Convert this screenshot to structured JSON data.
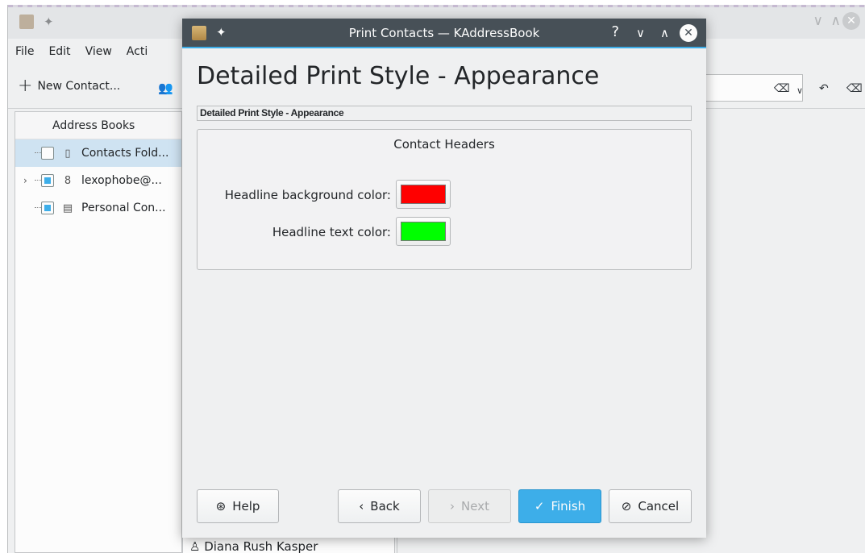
{
  "background_window": {
    "menu": [
      "File",
      "Edit",
      "View",
      "Acti"
    ],
    "toolbar": {
      "new_contact_label": "New Contact..."
    },
    "address_books_header": "Address Books",
    "address_books": [
      {
        "label": "Contacts Fold...",
        "icon": "folder-icon",
        "selected": true
      },
      {
        "label": "lexophobe@...",
        "icon": "google-icon",
        "selected": false
      },
      {
        "label": "Personal Con...",
        "icon": "addressbook-icon",
        "selected": false
      }
    ],
    "contact_list_visible_item": "Diana Rush Kasper"
  },
  "dialog": {
    "window_title": "Print Contacts — KAddressBook",
    "heading": "Detailed Print Style - Appearance",
    "subtitle": "Detailed Print Style - Appearance",
    "group": {
      "title": "Contact Headers",
      "headline_bg_label": "Headline background color:",
      "headline_bg_color": "#ff0000",
      "headline_text_label": "Headline text color:",
      "headline_text_color": "#00ff00"
    },
    "buttons": {
      "help": "Help",
      "back": "Back",
      "next": "Next",
      "finish": "Finish",
      "cancel": "Cancel"
    }
  },
  "colors": {
    "titlebar": "#475057",
    "accent": "#3daee9",
    "window_bg": "#eff0f1"
  }
}
